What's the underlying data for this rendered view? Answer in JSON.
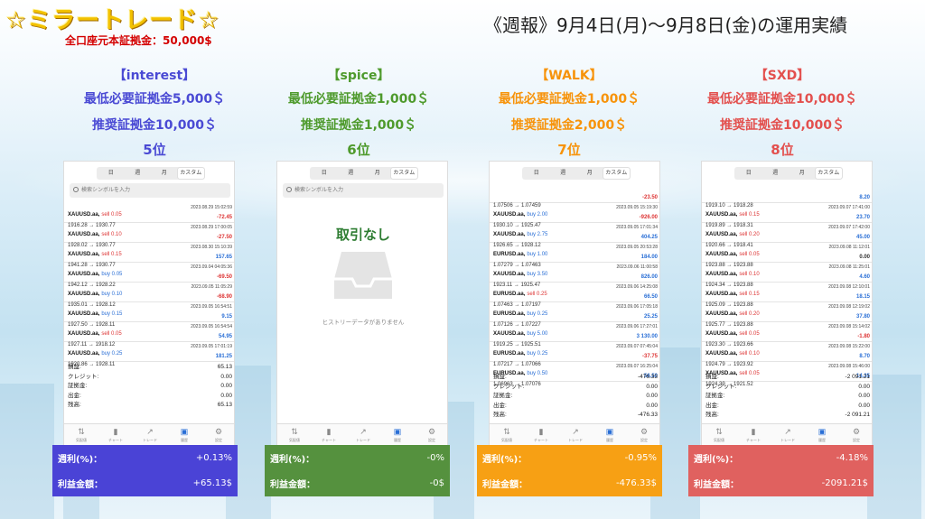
{
  "header": {
    "title": "☆ミラートレード☆",
    "subtitle": "全口座元本証拠金：50,000$",
    "week": "《週報》9月4日(月)〜9月8日(金)の運用実績"
  },
  "phone_ui": {
    "tabs": [
      "日",
      "週",
      "月",
      "カスタム"
    ],
    "search_placeholder": "検索シンボルを入力",
    "nav": [
      "気配値",
      "チャート",
      "トレード",
      "履歴",
      "設定"
    ]
  },
  "result_labels": {
    "rate": "週利(%)：",
    "profit": "利益金額："
  },
  "strategies": [
    {
      "name": "【interest】",
      "min_margin": "最低必要証拠金5,000＄",
      "rec_margin": "推奨証拠金10,000＄",
      "rank": "5位",
      "color": "#4a4ad4",
      "result_bg": "#4a43d6",
      "rate": "+0.13%",
      "profit": "+65.13$",
      "trades": [
        {
          "symbol": "XAUUSD.aa,",
          "side": "sell 0.05",
          "dir": "sell",
          "date": "2023.08.29 15:02:59",
          "prices": "1916.28 → 1930.77",
          "pl": "-72.45",
          "sign": "neg"
        },
        {
          "symbol": "XAUUSD.aa,",
          "side": "sell 0.10",
          "dir": "sell",
          "date": "2023.08.29 17:00:05",
          "prices": "1928.02 → 1930.77",
          "pl": "-27.50",
          "sign": "neg"
        },
        {
          "symbol": "XAUUSD.aa,",
          "side": "sell 0.15",
          "dir": "sell",
          "date": "2023.08.30 15:10:39",
          "prices": "1941.28 → 1930.77",
          "pl": "157.65",
          "sign": "pos"
        },
        {
          "symbol": "XAUUSD.aa,",
          "side": "buy 0.05",
          "dir": "buy",
          "date": "2023.09.04 04:05:36",
          "prices": "1942.12 → 1928.22",
          "pl": "-69.50",
          "sign": "neg"
        },
        {
          "symbol": "XAUUSD.aa,",
          "side": "buy 0.10",
          "dir": "buy",
          "date": "2023.09.05 11:05:29",
          "prices": "1935.01 → 1928.12",
          "pl": "-68.90",
          "sign": "neg"
        },
        {
          "symbol": "XAUUSD.aa,",
          "side": "buy 0.15",
          "dir": "buy",
          "date": "2023.09.05 16:54:51",
          "prices": "1927.50 → 1928.11",
          "pl": "9.15",
          "sign": "pos"
        },
        {
          "symbol": "XAUUSD.aa,",
          "side": "sell 0.05",
          "dir": "sell",
          "date": "2023.09.05 16:54:54",
          "prices": "1927.11 → 1918.12",
          "pl": "54.95",
          "sign": "pos"
        },
        {
          "symbol": "XAUUSD.aa,",
          "side": "buy 0.25",
          "dir": "buy",
          "date": "2023.09.05 17:01:19",
          "prices": "1920.86 → 1928.11",
          "pl": "181.25",
          "sign": "pos"
        }
      ],
      "summary": [
        {
          "label": "損益:",
          "value": "65.13"
        },
        {
          "label": "クレジット:",
          "value": "0.00"
        },
        {
          "label": "証拠金:",
          "value": "0.00"
        },
        {
          "label": "出金:",
          "value": "0.00"
        },
        {
          "label": "残高:",
          "value": "65.13"
        }
      ]
    },
    {
      "name": "【spice】",
      "min_margin": "最低必要証拠金1,000＄",
      "rec_margin": "推奨証拠金1,000＄",
      "rank": "6位",
      "color": "#4e9a2c",
      "result_bg": "#55913e",
      "rate": "-0%",
      "profit": "-0$",
      "empty_title": "取引なし",
      "empty_text": "ヒストリーデータがありません"
    },
    {
      "name": "【WALK】",
      "min_margin": "最低必要証拠金1,000＄",
      "rec_margin": "推奨証拠金2,000＄",
      "rank": "7位",
      "color": "#f7930a",
      "result_bg": "#f7a014",
      "rate": "-0.95%",
      "profit": "-476.33$",
      "trades": [
        {
          "symbol": "",
          "side": "",
          "dir": "buy",
          "date": "",
          "prices": "1.07506 → 1.07459",
          "pl": "-23.50",
          "sign": "neg"
        },
        {
          "symbol": "XAUUSD.aa,",
          "side": "buy 2.00",
          "dir": "buy",
          "date": "2023.09.05 15:19:30",
          "prices": "1930.10 → 1925.47",
          "pl": "-926.00",
          "sign": "neg"
        },
        {
          "symbol": "XAUUSD.aa,",
          "side": "buy 2.75",
          "dir": "buy",
          "date": "2023.09.05 17:01:34",
          "prices": "1926.65 → 1928.12",
          "pl": "404.25",
          "sign": "pos"
        },
        {
          "symbol": "EURUSD.aa,",
          "side": "buy 1.00",
          "dir": "buy",
          "date": "2023.09.05 20:53:28",
          "prices": "1.07279 → 1.07463",
          "pl": "184.00",
          "sign": "pos"
        },
        {
          "symbol": "XAUUSD.aa,",
          "side": "buy 3.50",
          "dir": "buy",
          "date": "2023.09.06 11:00:58",
          "prices": "1923.11 → 1925.47",
          "pl": "826.00",
          "sign": "pos"
        },
        {
          "symbol": "EURUSD.aa,",
          "side": "sell 0.25",
          "dir": "sell",
          "date": "2023.09.06 14:25:08",
          "prices": "1.07463 → 1.07197",
          "pl": "66.50",
          "sign": "pos"
        },
        {
          "symbol": "EURUSD.aa,",
          "side": "buy 0.25",
          "dir": "buy",
          "date": "2023.09.06 17:05:18",
          "prices": "1.07126 → 1.07227",
          "pl": "25.25",
          "sign": "pos"
        },
        {
          "symbol": "XAUUSD.aa,",
          "side": "buy 5.00",
          "dir": "buy",
          "date": "2023.09.06 17:27:01",
          "prices": "1919.25 → 1925.51",
          "pl": "3 130.00",
          "sign": "pos"
        },
        {
          "symbol": "EURUSD.aa,",
          "side": "buy 0.25",
          "dir": "buy",
          "date": "2023.09.07 07:45:04",
          "prices": "1.07217 → 1.07066",
          "pl": "-37.75",
          "sign": "neg"
        },
        {
          "symbol": "EURUSD.aa,",
          "side": "buy 0.50",
          "dir": "buy",
          "date": "2023.09.07 16:25:04",
          "prices": "1.06963 → 1.07076",
          "pl": "56.50",
          "sign": "pos"
        }
      ],
      "summary": [
        {
          "label": "損益:",
          "value": "-476.33"
        },
        {
          "label": "クレジット:",
          "value": "0.00"
        },
        {
          "label": "証拠金:",
          "value": "0.00"
        },
        {
          "label": "出金:",
          "value": "0.00"
        },
        {
          "label": "残高:",
          "value": "-476.33"
        }
      ]
    },
    {
      "name": "【SXD】",
      "min_margin": "最低必要証拠金10,000＄",
      "rec_margin": "推奨証拠金10,000＄",
      "rank": "8位",
      "color": "#e3504e",
      "result_bg": "#e0615f",
      "rate": "-4.18%",
      "profit": "-2091.21$",
      "trades": [
        {
          "symbol": "",
          "side": "",
          "dir": "buy",
          "date": "",
          "prices": "1919.10 → 1918.28",
          "pl": "8.20",
          "sign": "pos"
        },
        {
          "symbol": "XAUUSD.aa,",
          "side": "sell 0.15",
          "dir": "sell",
          "date": "2023.09.07 17:41:00",
          "prices": "1919.89 → 1918.31",
          "pl": "23.70",
          "sign": "pos"
        },
        {
          "symbol": "XAUUSD.aa,",
          "side": "sell 0.20",
          "dir": "sell",
          "date": "2023.09.07 17:42:00",
          "prices": "1920.66 → 1918.41",
          "pl": "45.00",
          "sign": "pos"
        },
        {
          "symbol": "XAUUSD.aa,",
          "side": "sell 0.05",
          "dir": "sell",
          "date": "2023.09.08 11:12:01",
          "prices": "1923.88 → 1923.88",
          "pl": "0.00",
          "sign": "zero"
        },
        {
          "symbol": "XAUUSD.aa,",
          "side": "sell 0.10",
          "dir": "sell",
          "date": "2023.09.08 11:25:01",
          "prices": "1924.34 → 1923.88",
          "pl": "4.60",
          "sign": "pos"
        },
        {
          "symbol": "XAUUSD.aa,",
          "side": "sell 0.15",
          "dir": "sell",
          "date": "2023.09.08 12:10:01",
          "prices": "1925.09 → 1923.88",
          "pl": "18.15",
          "sign": "pos"
        },
        {
          "symbol": "XAUUSD.aa,",
          "side": "sell 0.20",
          "dir": "sell",
          "date": "2023.09.08 12:19:02",
          "prices": "1925.77 → 1923.88",
          "pl": "37.80",
          "sign": "pos"
        },
        {
          "symbol": "XAUUSD.aa,",
          "side": "sell 0.05",
          "dir": "sell",
          "date": "2023.09.08 15:14:02",
          "prices": "1923.30 → 1923.66",
          "pl": "-1.80",
          "sign": "neg"
        },
        {
          "symbol": "XAUUSD.aa,",
          "side": "sell 0.10",
          "dir": "sell",
          "date": "2023.09.08 15:22:00",
          "prices": "1924.79 → 1923.92",
          "pl": "8.70",
          "sign": "pos"
        },
        {
          "symbol": "XAUUSD.aa,",
          "side": "sell 0.05",
          "dir": "sell",
          "date": "2023.09.08 15:46:00",
          "prices": "1924.39 → 1921.52",
          "pl": "14.35",
          "sign": "pos"
        }
      ],
      "summary": [
        {
          "label": "損益:",
          "value": "-2 091.21"
        },
        {
          "label": "クレジット:",
          "value": "0.00"
        },
        {
          "label": "証拠金:",
          "value": "0.00"
        },
        {
          "label": "出金:",
          "value": "0.00"
        },
        {
          "label": "残高:",
          "value": "-2 091.21"
        }
      ]
    }
  ]
}
